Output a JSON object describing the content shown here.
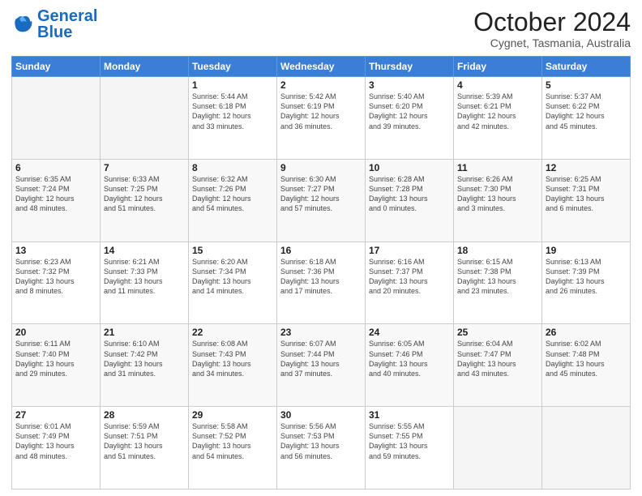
{
  "logo": {
    "text_general": "General",
    "text_blue": "Blue"
  },
  "header": {
    "month": "October 2024",
    "location": "Cygnet, Tasmania, Australia"
  },
  "days_of_week": [
    "Sunday",
    "Monday",
    "Tuesday",
    "Wednesday",
    "Thursday",
    "Friday",
    "Saturday"
  ],
  "weeks": [
    [
      {
        "day": "",
        "info": ""
      },
      {
        "day": "",
        "info": ""
      },
      {
        "day": "1",
        "info": "Sunrise: 5:44 AM\nSunset: 6:18 PM\nDaylight: 12 hours\nand 33 minutes."
      },
      {
        "day": "2",
        "info": "Sunrise: 5:42 AM\nSunset: 6:19 PM\nDaylight: 12 hours\nand 36 minutes."
      },
      {
        "day": "3",
        "info": "Sunrise: 5:40 AM\nSunset: 6:20 PM\nDaylight: 12 hours\nand 39 minutes."
      },
      {
        "day": "4",
        "info": "Sunrise: 5:39 AM\nSunset: 6:21 PM\nDaylight: 12 hours\nand 42 minutes."
      },
      {
        "day": "5",
        "info": "Sunrise: 5:37 AM\nSunset: 6:22 PM\nDaylight: 12 hours\nand 45 minutes."
      }
    ],
    [
      {
        "day": "6",
        "info": "Sunrise: 6:35 AM\nSunset: 7:24 PM\nDaylight: 12 hours\nand 48 minutes."
      },
      {
        "day": "7",
        "info": "Sunrise: 6:33 AM\nSunset: 7:25 PM\nDaylight: 12 hours\nand 51 minutes."
      },
      {
        "day": "8",
        "info": "Sunrise: 6:32 AM\nSunset: 7:26 PM\nDaylight: 12 hours\nand 54 minutes."
      },
      {
        "day": "9",
        "info": "Sunrise: 6:30 AM\nSunset: 7:27 PM\nDaylight: 12 hours\nand 57 minutes."
      },
      {
        "day": "10",
        "info": "Sunrise: 6:28 AM\nSunset: 7:28 PM\nDaylight: 13 hours\nand 0 minutes."
      },
      {
        "day": "11",
        "info": "Sunrise: 6:26 AM\nSunset: 7:30 PM\nDaylight: 13 hours\nand 3 minutes."
      },
      {
        "day": "12",
        "info": "Sunrise: 6:25 AM\nSunset: 7:31 PM\nDaylight: 13 hours\nand 6 minutes."
      }
    ],
    [
      {
        "day": "13",
        "info": "Sunrise: 6:23 AM\nSunset: 7:32 PM\nDaylight: 13 hours\nand 8 minutes."
      },
      {
        "day": "14",
        "info": "Sunrise: 6:21 AM\nSunset: 7:33 PM\nDaylight: 13 hours\nand 11 minutes."
      },
      {
        "day": "15",
        "info": "Sunrise: 6:20 AM\nSunset: 7:34 PM\nDaylight: 13 hours\nand 14 minutes."
      },
      {
        "day": "16",
        "info": "Sunrise: 6:18 AM\nSunset: 7:36 PM\nDaylight: 13 hours\nand 17 minutes."
      },
      {
        "day": "17",
        "info": "Sunrise: 6:16 AM\nSunset: 7:37 PM\nDaylight: 13 hours\nand 20 minutes."
      },
      {
        "day": "18",
        "info": "Sunrise: 6:15 AM\nSunset: 7:38 PM\nDaylight: 13 hours\nand 23 minutes."
      },
      {
        "day": "19",
        "info": "Sunrise: 6:13 AM\nSunset: 7:39 PM\nDaylight: 13 hours\nand 26 minutes."
      }
    ],
    [
      {
        "day": "20",
        "info": "Sunrise: 6:11 AM\nSunset: 7:40 PM\nDaylight: 13 hours\nand 29 minutes."
      },
      {
        "day": "21",
        "info": "Sunrise: 6:10 AM\nSunset: 7:42 PM\nDaylight: 13 hours\nand 31 minutes."
      },
      {
        "day": "22",
        "info": "Sunrise: 6:08 AM\nSunset: 7:43 PM\nDaylight: 13 hours\nand 34 minutes."
      },
      {
        "day": "23",
        "info": "Sunrise: 6:07 AM\nSunset: 7:44 PM\nDaylight: 13 hours\nand 37 minutes."
      },
      {
        "day": "24",
        "info": "Sunrise: 6:05 AM\nSunset: 7:46 PM\nDaylight: 13 hours\nand 40 minutes."
      },
      {
        "day": "25",
        "info": "Sunrise: 6:04 AM\nSunset: 7:47 PM\nDaylight: 13 hours\nand 43 minutes."
      },
      {
        "day": "26",
        "info": "Sunrise: 6:02 AM\nSunset: 7:48 PM\nDaylight: 13 hours\nand 45 minutes."
      }
    ],
    [
      {
        "day": "27",
        "info": "Sunrise: 6:01 AM\nSunset: 7:49 PM\nDaylight: 13 hours\nand 48 minutes."
      },
      {
        "day": "28",
        "info": "Sunrise: 5:59 AM\nSunset: 7:51 PM\nDaylight: 13 hours\nand 51 minutes."
      },
      {
        "day": "29",
        "info": "Sunrise: 5:58 AM\nSunset: 7:52 PM\nDaylight: 13 hours\nand 54 minutes."
      },
      {
        "day": "30",
        "info": "Sunrise: 5:56 AM\nSunset: 7:53 PM\nDaylight: 13 hours\nand 56 minutes."
      },
      {
        "day": "31",
        "info": "Sunrise: 5:55 AM\nSunset: 7:55 PM\nDaylight: 13 hours\nand 59 minutes."
      },
      {
        "day": "",
        "info": ""
      },
      {
        "day": "",
        "info": ""
      }
    ]
  ]
}
